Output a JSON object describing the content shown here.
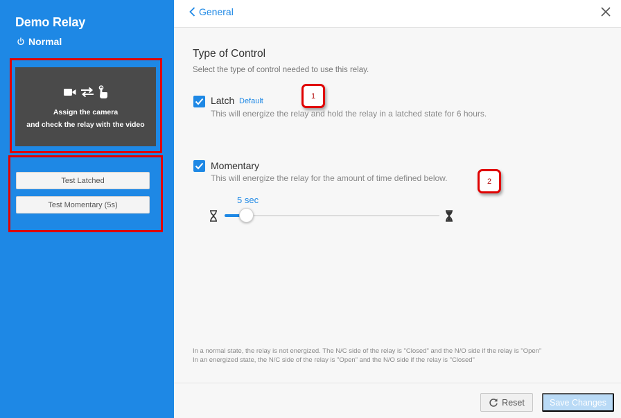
{
  "sidebar": {
    "title": "Demo Relay",
    "status": "Normal",
    "camera_card": {
      "line1": "Assign the camera",
      "line2": "and check the relay with the video"
    },
    "buttons": {
      "test_latched": "Test Latched",
      "test_momentary": "Test Momentary (5s)"
    }
  },
  "header": {
    "back_label": "General"
  },
  "control": {
    "title": "Type of Control",
    "subtitle": "Select the type of control needed to use this relay.",
    "latch": {
      "label": "Latch",
      "badge": "Default",
      "description": "This will energize the relay and hold the relay in a latched state for 6 hours.",
      "checked": true
    },
    "momentary": {
      "label": "Momentary",
      "description": "This will energize the relay for the amount of time defined below.",
      "checked": true
    },
    "slider": {
      "value_label": "5 sec",
      "fraction": 0.1
    }
  },
  "annotations": {
    "callout1": "1",
    "callout2": "2"
  },
  "notes": {
    "line1": "In a normal state, the relay is not energized. The N/C side of the relay is \"Closed\" and the N/O side if the relay is \"Open\"",
    "line2": "In an energized state, the N/C side of the relay is \"Open\" and the N/O side if the relay is \"Closed\""
  },
  "footer": {
    "reset_label": "Reset",
    "save_label": "Save Changes"
  },
  "colors": {
    "accent": "#1e88e5",
    "annotation_red": "#e00000",
    "camera_card_bg": "#4a4a4a"
  }
}
